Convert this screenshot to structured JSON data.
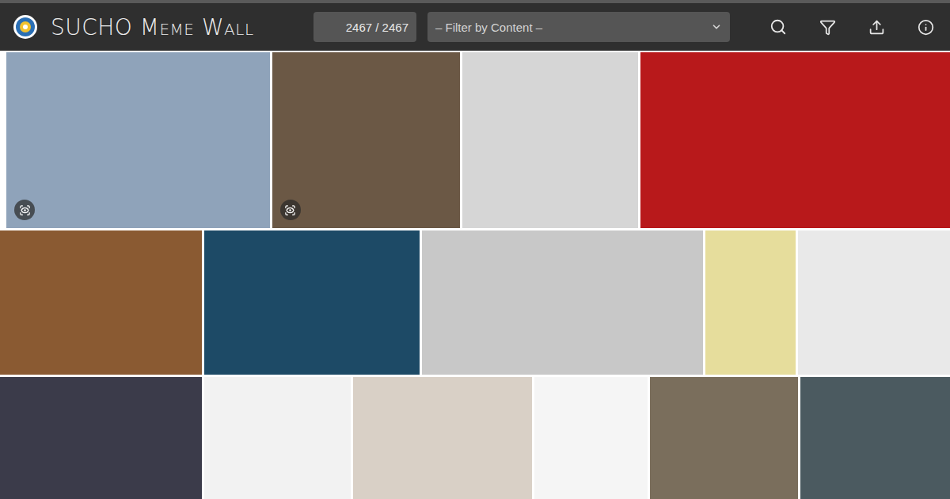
{
  "header": {
    "title": "SUCHO Meme Wall",
    "counter": "2467 / 2467",
    "filter": {
      "placeholder": "– Filter by Content –"
    }
  },
  "wall": {
    "rows": [
      [
        {
          "color": "#8fa3ba",
          "gallery": true
        },
        {
          "color": "#6b5845",
          "gallery": true
        },
        {
          "color": "#d6d6d6",
          "gallery": false
        },
        {
          "color": "#b8191b",
          "gallery": false
        }
      ],
      [
        {
          "color": "#8a5a32",
          "gallery": false
        },
        {
          "color": "#1d4a66",
          "gallery": false
        },
        {
          "color": "#c8c8c8",
          "gallery": false
        },
        {
          "color": "#e6dd9c",
          "gallery": false
        },
        {
          "color": "#e9e9e9",
          "gallery": false
        }
      ],
      [
        {
          "color": "#3b3b4a",
          "gallery": false
        },
        {
          "color": "#f2f2f2",
          "gallery": false
        },
        {
          "color": "#d9d0c6",
          "gallery": false
        },
        {
          "color": "#f5f5f5",
          "gallery": false
        },
        {
          "color": "#7a6e5c",
          "gallery": false
        },
        {
          "color": "#4b5a60",
          "gallery": false
        }
      ]
    ]
  }
}
